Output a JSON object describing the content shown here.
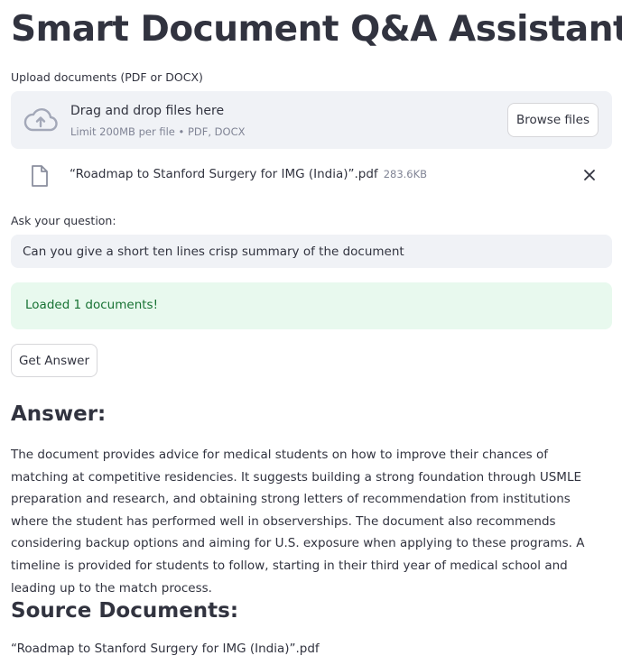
{
  "header": {
    "title": "Smart Document Q&A Assistant"
  },
  "uploader": {
    "label": "Upload documents (PDF or DOCX)",
    "drop_title": "Drag and drop files here",
    "drop_subtitle": "Limit 200MB per file • PDF, DOCX",
    "browse_label": "Browse files",
    "file": {
      "name": "“Roadmap to Stanford Surgery for IMG (India)”.pdf",
      "size": "283.6KB"
    },
    "icons": [
      "cloud-upload-icon",
      "file-icon",
      "close-icon"
    ]
  },
  "question": {
    "label": "Ask your question:",
    "value": "Can you give a short ten lines crisp summary of the document"
  },
  "status": {
    "message": "Loaded 1 documents!",
    "color": "#177233",
    "background": "#e8f9ee"
  },
  "actions": {
    "get_answer_label": "Get Answer"
  },
  "answer": {
    "heading": "Answer:",
    "text": "The document provides advice for medical students on how to improve their chances of matching at competitive residencies. It suggests building a strong foundation through USMLE preparation and research, and obtaining strong letters of recommendation from institutions where the student has performed well in observerships. The document also recommends considering backup options and aiming for U.S. exposure when applying to these programs. A timeline is provided for students to follow, starting in their third year of medical school and leading up to the match process."
  },
  "sources": {
    "heading": "Source Documents:",
    "items": [
      "“Roadmap to Stanford Surgery for IMG (India)”.pdf"
    ]
  }
}
